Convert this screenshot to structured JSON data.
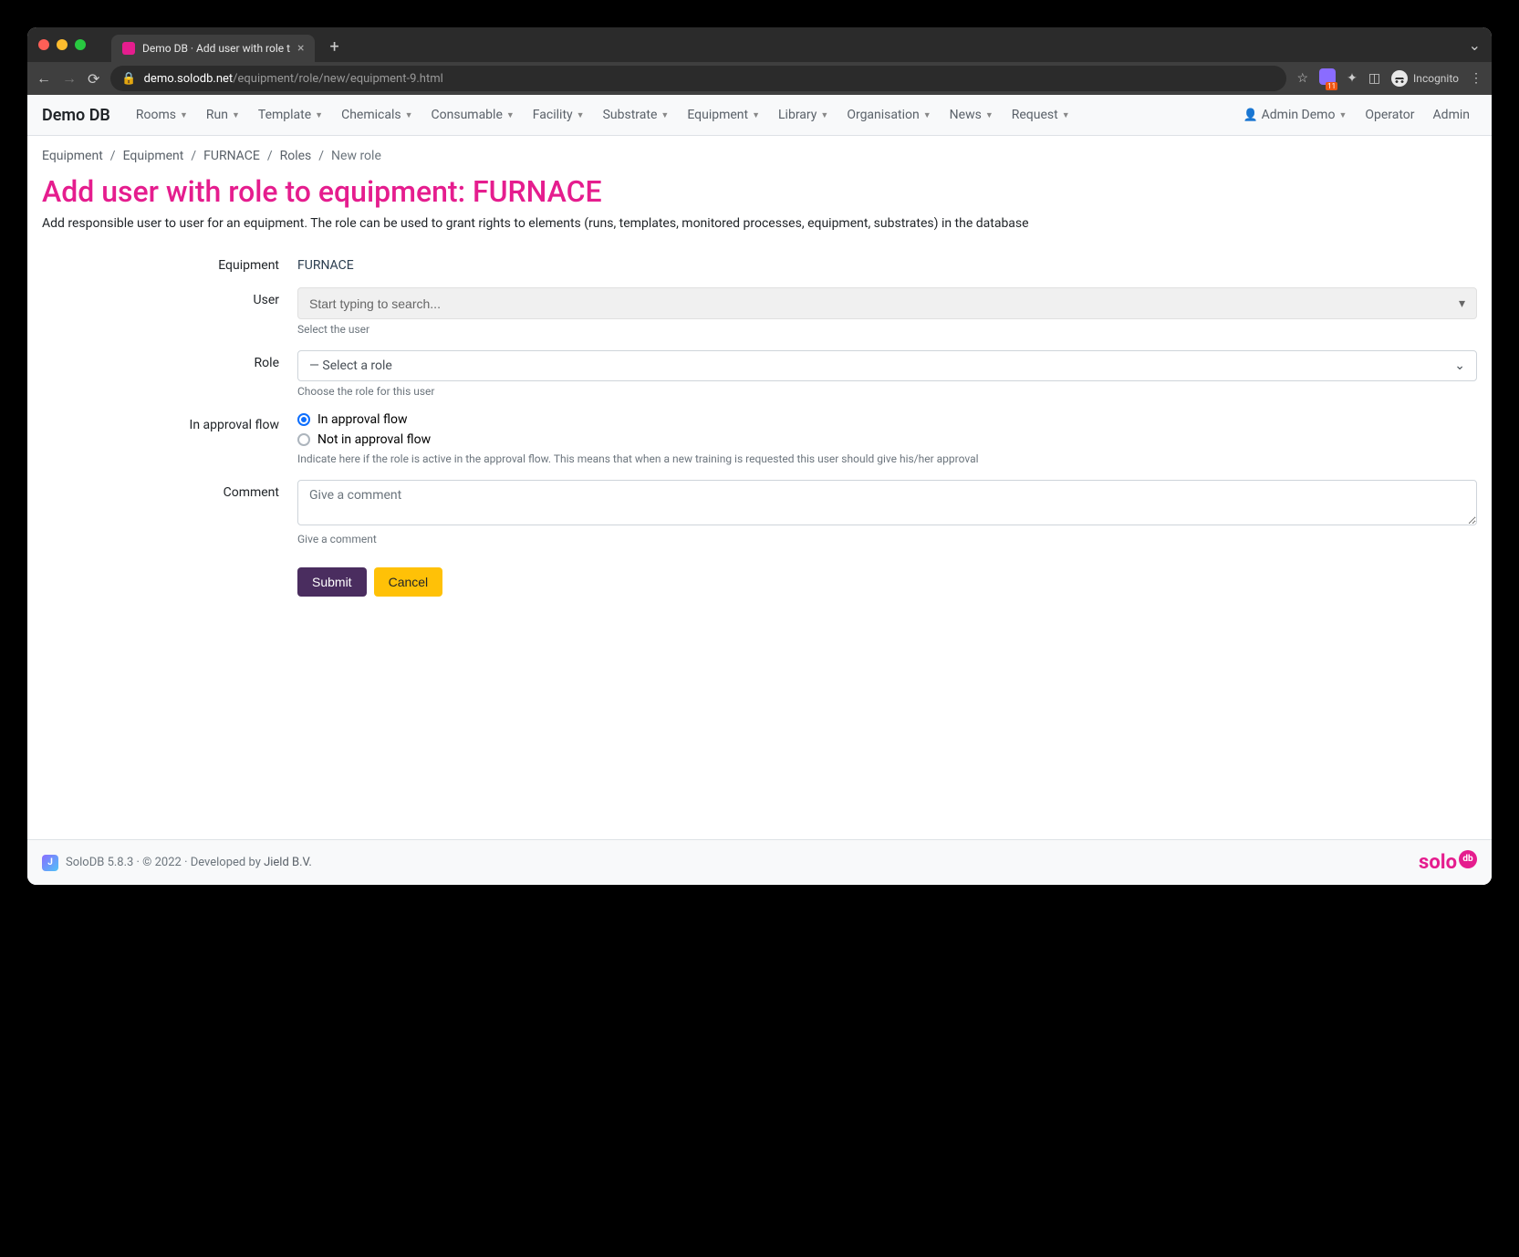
{
  "browser": {
    "tab_title": "Demo DB · Add user with role t",
    "url_host": "demo.solodb.net",
    "url_path": "/equipment/role/new/equipment-9.html",
    "ext_badge": "11",
    "incognito_label": "Incognito"
  },
  "navbar": {
    "brand": "Demo DB",
    "menu": [
      "Rooms",
      "Run",
      "Template",
      "Chemicals",
      "Consumable",
      "Facility",
      "Substrate",
      "Equipment",
      "Library",
      "Organisation",
      "News",
      "Request"
    ],
    "user_menu": "Admin Demo",
    "right_links": [
      "Operator",
      "Admin"
    ]
  },
  "breadcrumb": {
    "items": [
      "Equipment",
      "Equipment",
      "FURNACE",
      "Roles",
      "New role"
    ]
  },
  "page": {
    "title": "Add user with role to equipment: FURNACE",
    "subtitle": "Add responsible user to user for an equipment. The role can be used to grant rights to elements (runs, templates, monitored processes, equipment, substrates) in the database"
  },
  "form": {
    "equipment": {
      "label": "Equipment",
      "value": "FURNACE"
    },
    "user": {
      "label": "User",
      "placeholder": "Start typing to search...",
      "help": "Select the user"
    },
    "role": {
      "label": "Role",
      "placeholder": "— Select a role",
      "help": "Choose the role for this user"
    },
    "approval": {
      "label": "In approval flow",
      "option1": "In approval flow",
      "option2": "Not in approval flow",
      "help": "Indicate here if the role is active in the approval flow. This means that when a new training is requested this user should give his/her approval"
    },
    "comment": {
      "label": "Comment",
      "placeholder": "Give a comment",
      "help": "Give a comment"
    },
    "submit": "Submit",
    "cancel": "Cancel"
  },
  "footer": {
    "text": "SoloDB 5.8.3 · © 2022 · Developed by ",
    "link": "Jield B.V.",
    "logo_text": "solo",
    "logo_badge": "db"
  }
}
